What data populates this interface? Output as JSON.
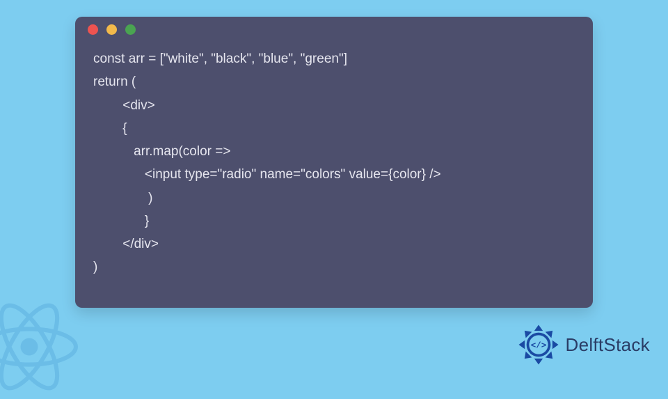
{
  "window": {
    "dots": {
      "red": "#ed5350",
      "yellow": "#f2b94b",
      "green": "#4aa451"
    }
  },
  "code": {
    "lines": [
      "const arr = [\"white\", \"black\", \"blue\", \"green\"]",
      "return (",
      "        <div>",
      "        {",
      "           arr.map(color =>",
      "              <input type=\"radio\" name=\"colors\" value={color} />",
      "               )",
      "              }",
      "        </div>",
      ")"
    ]
  },
  "brand": {
    "name": "DelftStack"
  },
  "watermark": {
    "icon": "react-icon"
  },
  "colors": {
    "page_bg": "#7dcdf0",
    "window_bg": "#4d4f6d",
    "code_text": "#e6e6ef",
    "brand_text": "#2a3d66",
    "brand_accent": "#1a4aa3"
  }
}
